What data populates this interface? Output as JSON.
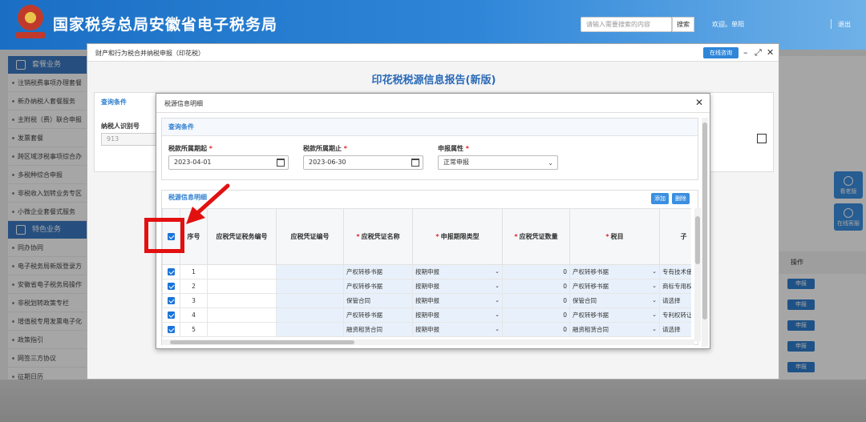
{
  "header": {
    "title": "国家税务总局安徽省电子税务局",
    "search_placeholder": "请输入需要搜索的内容",
    "search_button": "搜索",
    "welcome": "欢迎。单阳",
    "logout": "退出"
  },
  "sidebar": {
    "section1": "套餐业务",
    "items1": [
      "注销税费事项办理套餐",
      "新办纳税人套餐服务",
      "主附税（费）联合申报",
      "发票套餐",
      "跨区域涉税事项综合办",
      "多税种综合申报",
      "非税收入划转业务专区",
      "小微企业套餐式服务"
    ],
    "section2": "特色业务",
    "items2": [
      "同办协同",
      "电子税务局新版登录方",
      "安徽省电子税务局操作",
      "非税划转政策专栏",
      "增值税专用发票电子化",
      "政策指引",
      "网签三方协议",
      "征期日历"
    ]
  },
  "right_panel": {
    "op_header": "操作",
    "apply_button": "申报"
  },
  "float_buttons": [
    "看老版",
    "在线客服"
  ],
  "outer_dialog": {
    "title": "财产和行为税合并纳税申报（印花税）",
    "online_button": "在线咨询",
    "report_title": "印花税税源信息报告(新版)",
    "query_label": "查询条件",
    "taxpayer_id_label": "纳税人识别号",
    "taxpayer_id_value": "913"
  },
  "inner_dialog": {
    "title": "税源信息明细",
    "query_title": "查询条件",
    "fields": {
      "start_label": "税款所属期起",
      "start_value": "2023-04-01",
      "end_label": "税款所属期止",
      "end_value": "2023-06-30",
      "attr_label": "申报属性",
      "attr_value": "正常申报"
    },
    "detail_title": "税源信息明细",
    "add_button": "添加",
    "delete_button": "删除",
    "columns": [
      "序号",
      "应税凭证税务编号",
      "应税凭证编号",
      "应税凭证名称",
      "申报期限类型",
      "应税凭证数量",
      "税目",
      "子"
    ],
    "rows": [
      {
        "no": "1",
        "name": "产权转移书据",
        "period": "按期申报",
        "qty": "0",
        "item": "产权转移书据",
        "sub": "专有技术使"
      },
      {
        "no": "2",
        "name": "产权转移书据",
        "period": "按期申报",
        "qty": "0",
        "item": "产权转移书据",
        "sub": "商标专用权"
      },
      {
        "no": "3",
        "name": "保管合同",
        "period": "按期申报",
        "qty": "0",
        "item": "保管合同",
        "sub": "请选择"
      },
      {
        "no": "4",
        "name": "产权转移书据",
        "period": "按期申报",
        "qty": "0",
        "item": "产权转移书据",
        "sub": "专利权转让"
      },
      {
        "no": "5",
        "name": "融资租赁合同",
        "period": "按期申报",
        "qty": "0",
        "item": "融资租赁合同",
        "sub": "请选择"
      }
    ]
  },
  "colors": {
    "header_blue": "#2f86d8",
    "accent_blue": "#3b8fe0",
    "highlight_red": "#e31010"
  }
}
